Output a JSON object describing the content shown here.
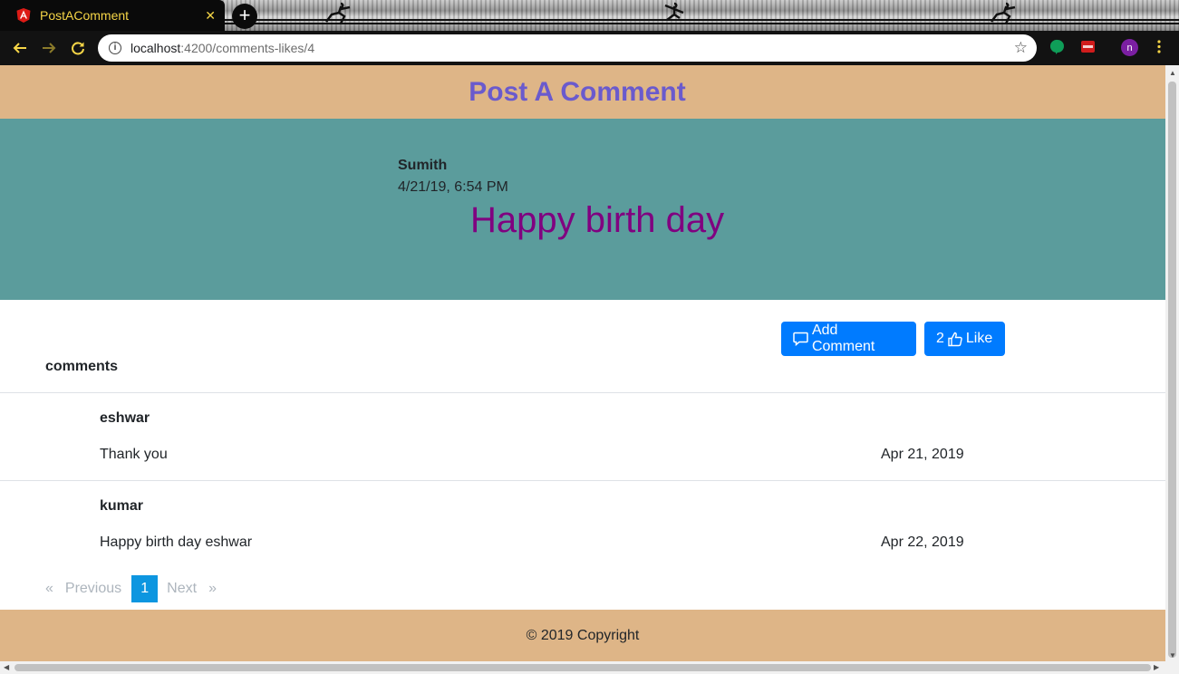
{
  "browser": {
    "tab_title": "PostAComment",
    "url_host": "localhost",
    "url_path": ":4200/comments-likes/4",
    "new_tab_label": "+"
  },
  "header": {
    "title": "Post A Comment"
  },
  "post": {
    "author": "Sumith",
    "date": "4/21/19, 6:54 PM",
    "message": "Happy birth day"
  },
  "actions": {
    "add_comment_label": "Add Comment",
    "like_count": "2",
    "like_label": "Like"
  },
  "comments_label": "comments",
  "comments": [
    {
      "name": "eshwar",
      "text": "Thank you",
      "date": "Apr 21, 2019"
    },
    {
      "name": "kumar",
      "text": "Happy birth day eshwar",
      "date": "Apr 22, 2019"
    }
  ],
  "pagination": {
    "first_arrow": "«",
    "previous_label": "Previous",
    "current_page": "1",
    "next_label": "Next",
    "last_arrow": "»"
  },
  "footer": {
    "text": "© 2019 Copyright"
  },
  "colors": {
    "header_bg": "#deb587",
    "title_color": "#6a5acd",
    "post_bg": "#5b9c9c",
    "message_color": "#800080",
    "button_bg": "#007bff",
    "active_page_bg": "#0d96e0"
  }
}
